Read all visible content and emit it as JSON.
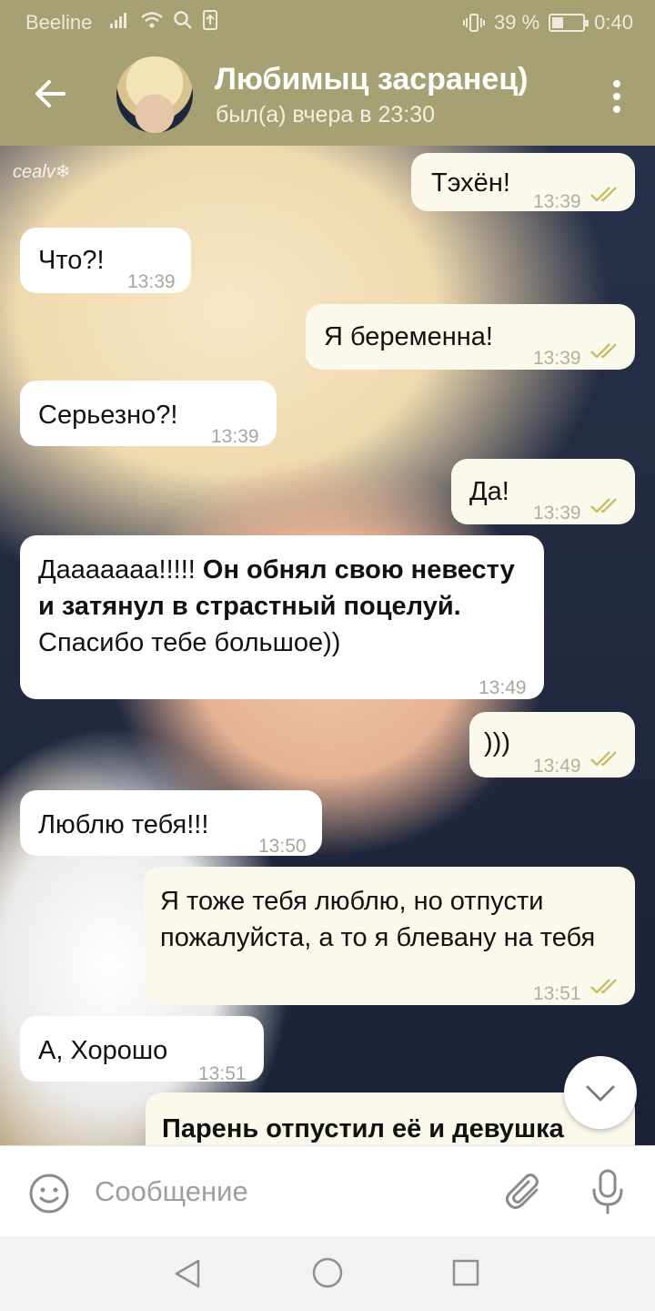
{
  "status_bar": {
    "carrier": "Beeline",
    "battery_percent": "39 %",
    "battery_level": 0.39,
    "time": "0:40"
  },
  "header": {
    "title": "Любимыц засранец)",
    "subtitle": "был(а) вчера в 23:30"
  },
  "chat": {
    "watermark": "cealv❄",
    "messages": [
      {
        "direction": "out",
        "text": "Тэхён!",
        "time": "13:39",
        "read": true
      },
      {
        "direction": "in",
        "text": "Что?!",
        "time": "13:39"
      },
      {
        "direction": "out",
        "text": "Я беременна!",
        "time": "13:39",
        "read": true
      },
      {
        "direction": "in",
        "text": "Серьезно?!",
        "time": "13:39"
      },
      {
        "direction": "out",
        "text": "Да!",
        "time": "13:39",
        "read": true
      },
      {
        "direction": "in",
        "text_plain_1": "Дааааааа!!!!!",
        "text_bold": "Он обнял свою невесту и затянул в страстный поцелуй.",
        "text_plain_2": "Спасибо тебе большое))",
        "time": "13:49"
      },
      {
        "direction": "out",
        "text": ")))",
        "time": "13:49",
        "read": true
      },
      {
        "direction": "in",
        "text": "Люблю тебя!!!",
        "time": "13:50"
      },
      {
        "direction": "out",
        "text": "Я тоже тебя люблю, но отпусти пожалуйста, а то я блевану на тебя",
        "time": "13:51",
        "read": true
      },
      {
        "direction": "in",
        "text": "А, Хорошо",
        "time": "13:51"
      },
      {
        "direction": "out",
        "text": "Парень отпустил её и девушка",
        "time": ""
      }
    ]
  },
  "composer": {
    "placeholder": "Сообщение"
  },
  "colors": {
    "header_bg": "#a5a173",
    "incoming_bubble": "#ffffff",
    "outgoing_bubble": "#fbf8ec",
    "read_check": "#c9b85a"
  }
}
